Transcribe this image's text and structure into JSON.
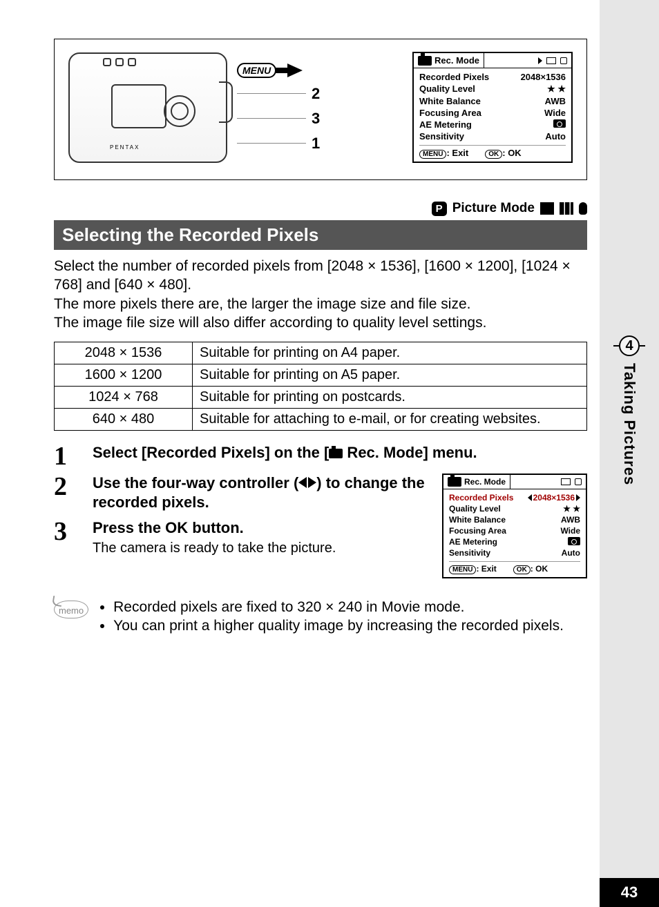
{
  "sidebar": {
    "chapter_number": "4",
    "chapter_title": "Taking Pictures",
    "page_number": "43"
  },
  "mode_row": {
    "badge": "P",
    "label": "Picture Mode"
  },
  "heading": "Selecting the Recorded Pixels",
  "intro_lines": {
    "l1": "Select the number of recorded pixels from [2048 × 1536], [1600 × 1200], [1024 × 768] and [640 × 480].",
    "l2": "The more pixels there are, the larger the image size and file size.",
    "l3": "The image file size will also differ according to quality level settings."
  },
  "pixel_table": [
    {
      "size": "2048 × 1536",
      "use": "Suitable for printing on A4 paper."
    },
    {
      "size": "1600 × 1200",
      "use": "Suitable for printing on A5 paper."
    },
    {
      "size": "1024 × 768",
      "use": "Suitable for printing on postcards."
    },
    {
      "size": "640 × 480",
      "use": "Suitable for attaching to e-mail, or for creating websites."
    }
  ],
  "steps": {
    "s1": {
      "num": "1",
      "title_before": "Select [Recorded Pixels] on the [",
      "title_after": " Rec. Mode] menu."
    },
    "s2": {
      "num": "2",
      "title": "Use the four-way controller (◀ ▶) to change the recorded pixels."
    },
    "s3": {
      "num": "3",
      "title": "Press the OK button.",
      "desc": "The camera is ready to take the picture."
    }
  },
  "memo": {
    "label": "memo",
    "items": [
      "Recorded pixels are fixed to 320 × 240 in Movie mode.",
      "You can print a higher quality image by increasing the recorded pixels."
    ]
  },
  "diagram": {
    "menu_label": "MENU",
    "pointer_2": "2",
    "pointer_3": "3",
    "pointer_1": "1",
    "camera_brand": "PENTAX"
  },
  "lcd_main": {
    "tab_active": "Rec. Mode",
    "rows": [
      {
        "label": "Recorded Pixels",
        "value": "2048×1536"
      },
      {
        "label": "Quality Level",
        "value": "★ ★"
      },
      {
        "label": "White Balance",
        "value": "AWB"
      },
      {
        "label": "Focusing Area",
        "value": "Wide"
      },
      {
        "label": "AE Metering",
        "value": "◎"
      },
      {
        "label": "Sensitivity",
        "value": "Auto"
      }
    ],
    "foot_menu": "MENU",
    "foot_exit": ": Exit",
    "foot_ok_badge": "OK",
    "foot_ok": ": OK"
  },
  "lcd_step": {
    "tab_active": "Rec. Mode",
    "rows": [
      {
        "label": "Recorded Pixels",
        "value": "2048×1536",
        "selected": true
      },
      {
        "label": "Quality Level",
        "value": "★ ★"
      },
      {
        "label": "White Balance",
        "value": "AWB"
      },
      {
        "label": "Focusing Area",
        "value": "Wide"
      },
      {
        "label": "AE Metering",
        "value": "◎"
      },
      {
        "label": "Sensitivity",
        "value": "Auto"
      }
    ],
    "foot_menu": "MENU",
    "foot_exit": ": Exit",
    "foot_ok_badge": "OK",
    "foot_ok": ": OK"
  }
}
